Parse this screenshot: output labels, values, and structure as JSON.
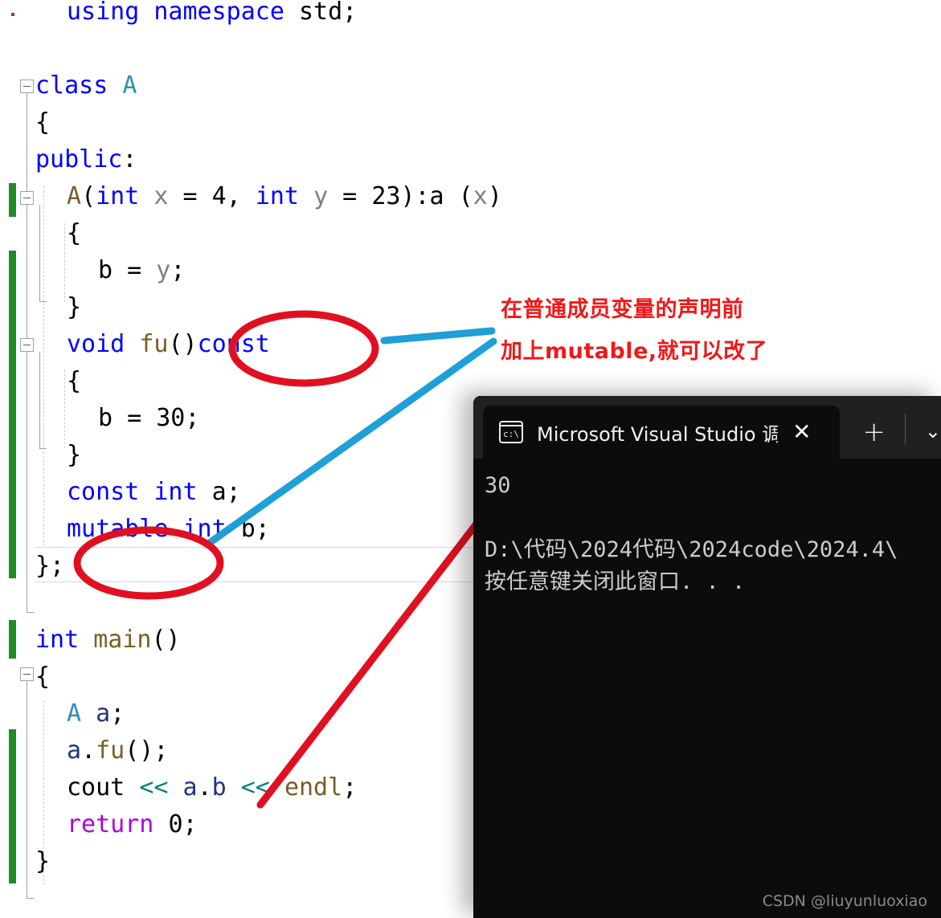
{
  "editor": {
    "lines": [
      {
        "indent": 1,
        "tokens": [
          {
            "t": "using",
            "c": "kw"
          },
          {
            "t": " ",
            "c": "plain"
          },
          {
            "t": "namespace",
            "c": "kw"
          },
          {
            "t": " std;",
            "c": "plain"
          }
        ]
      },
      {
        "indent": 0,
        "tokens": []
      },
      {
        "indent": 0,
        "tokens": [
          {
            "t": "class",
            "c": "kw"
          },
          {
            "t": " ",
            "c": "plain"
          },
          {
            "t": "A",
            "c": "type"
          }
        ]
      },
      {
        "indent": 0,
        "tokens": [
          {
            "t": "{",
            "c": "plain"
          }
        ]
      },
      {
        "indent": 0,
        "tokens": [
          {
            "t": "public",
            "c": "kw"
          },
          {
            "t": ":",
            "c": "plain"
          }
        ]
      },
      {
        "indent": 1,
        "tokens": [
          {
            "t": "A",
            "c": "fn"
          },
          {
            "t": "(",
            "c": "plain"
          },
          {
            "t": "int",
            "c": "kw"
          },
          {
            "t": " ",
            "c": "plain"
          },
          {
            "t": "x",
            "c": "var"
          },
          {
            "t": " = ",
            "c": "plain"
          },
          {
            "t": "4",
            "c": "num"
          },
          {
            "t": ", ",
            "c": "plain"
          },
          {
            "t": "int",
            "c": "kw"
          },
          {
            "t": " ",
            "c": "plain"
          },
          {
            "t": "y",
            "c": "var"
          },
          {
            "t": " = ",
            "c": "plain"
          },
          {
            "t": "23",
            "c": "num"
          },
          {
            "t": "):a (",
            "c": "plain"
          },
          {
            "t": "x",
            "c": "var"
          },
          {
            "t": ")",
            "c": "plain"
          }
        ]
      },
      {
        "indent": 1,
        "tokens": [
          {
            "t": "{",
            "c": "plain"
          }
        ]
      },
      {
        "indent": 2,
        "tokens": [
          {
            "t": "b",
            "c": "plain"
          },
          {
            "t": " = ",
            "c": "plain"
          },
          {
            "t": "y",
            "c": "var"
          },
          {
            "t": ";",
            "c": "plain"
          }
        ]
      },
      {
        "indent": 1,
        "tokens": [
          {
            "t": "}",
            "c": "plain"
          }
        ]
      },
      {
        "indent": 1,
        "tokens": [
          {
            "t": "void",
            "c": "kw"
          },
          {
            "t": " ",
            "c": "plain"
          },
          {
            "t": "fu",
            "c": "fn"
          },
          {
            "t": "()",
            "c": "plain"
          },
          {
            "t": "const",
            "c": "kw"
          }
        ]
      },
      {
        "indent": 1,
        "tokens": [
          {
            "t": "{",
            "c": "plain"
          }
        ]
      },
      {
        "indent": 2,
        "tokens": [
          {
            "t": "b",
            "c": "plain"
          },
          {
            "t": " = ",
            "c": "plain"
          },
          {
            "t": "30",
            "c": "num"
          },
          {
            "t": ";",
            "c": "plain"
          }
        ]
      },
      {
        "indent": 1,
        "tokens": [
          {
            "t": "}",
            "c": "plain"
          }
        ]
      },
      {
        "indent": 1,
        "tokens": [
          {
            "t": "const",
            "c": "kw"
          },
          {
            "t": " ",
            "c": "plain"
          },
          {
            "t": "int",
            "c": "kw"
          },
          {
            "t": " a;",
            "c": "plain"
          }
        ]
      },
      {
        "indent": 1,
        "tokens": [
          {
            "t": "mutable",
            "c": "mut"
          },
          {
            "t": " ",
            "c": "plain"
          },
          {
            "t": "int",
            "c": "kw"
          },
          {
            "t": " b;",
            "c": "plain"
          }
        ]
      },
      {
        "indent": 0,
        "tokens": [
          {
            "t": "};",
            "c": "plain"
          }
        ]
      },
      {
        "indent": 0,
        "tokens": []
      },
      {
        "indent": 0,
        "tokens": [
          {
            "t": "int",
            "c": "kw"
          },
          {
            "t": " ",
            "c": "plain"
          },
          {
            "t": "main",
            "c": "fn"
          },
          {
            "t": "()",
            "c": "plain"
          }
        ]
      },
      {
        "indent": 0,
        "tokens": [
          {
            "t": "{",
            "c": "plain"
          }
        ]
      },
      {
        "indent": 1,
        "tokens": [
          {
            "t": "A",
            "c": "type"
          },
          {
            "t": " ",
            "c": "plain"
          },
          {
            "t": "a",
            "c": "memb"
          },
          {
            "t": ";",
            "c": "plain"
          }
        ]
      },
      {
        "indent": 1,
        "tokens": [
          {
            "t": "a",
            "c": "memb"
          },
          {
            "t": ".",
            "c": "plain"
          },
          {
            "t": "fu",
            "c": "fn"
          },
          {
            "t": "();",
            "c": "plain"
          }
        ]
      },
      {
        "indent": 1,
        "tokens": [
          {
            "t": "cout",
            "c": "plain"
          },
          {
            "t": " ",
            "c": "plain"
          },
          {
            "t": "<<",
            "c": "shift"
          },
          {
            "t": " ",
            "c": "plain"
          },
          {
            "t": "a",
            "c": "memb"
          },
          {
            "t": ".",
            "c": "plain"
          },
          {
            "t": "b",
            "c": "memb"
          },
          {
            "t": " ",
            "c": "plain"
          },
          {
            "t": "<<",
            "c": "shift"
          },
          {
            "t": " ",
            "c": "plain"
          },
          {
            "t": "endl",
            "c": "fn"
          },
          {
            "t": ";",
            "c": "plain"
          }
        ]
      },
      {
        "indent": 1,
        "tokens": [
          {
            "t": "return",
            "c": "ctl"
          },
          {
            "t": " ",
            "c": "plain"
          },
          {
            "t": "0",
            "c": "num"
          },
          {
            "t": ";",
            "c": "plain"
          }
        ]
      },
      {
        "indent": 0,
        "tokens": [
          {
            "t": "}",
            "c": "plain"
          }
        ]
      }
    ],
    "plain_code": [
      "using namespace std;",
      "",
      "class A",
      "{",
      "public:",
      "    A(int x = 4, int y = 23):a (x)",
      "    {",
      "        b = y;",
      "    }",
      "    void fu()const",
      "    {",
      "        b = 30;",
      "    }",
      "    const int a;",
      "    mutable int b;",
      "};",
      "",
      "int main()",
      "{",
      "    A a;",
      "    a.fu();",
      "    cout << a.b << endl;",
      "    return 0;",
      "}"
    ]
  },
  "annotations": {
    "note_line1": "在普通成员变量的声明前",
    "note_line2": "加上mutable,就可以改了",
    "note_color": "#f01818",
    "ellipse_color": "#e01020",
    "blue_line_color": "#1e9fd8",
    "red_line_color": "#e01020",
    "circled_terms": [
      "const",
      "mutable"
    ]
  },
  "terminal": {
    "tab_title": "Microsoft Visual Studio 调试控",
    "tab_icon_label": "c:\\",
    "close_label": "✕",
    "new_tab_label": "+",
    "dropdown_label": "⌄",
    "output_lines": [
      "30",
      "",
      "D:\\代码\\2024代码\\2024code\\2024.4\\",
      "按任意键关闭此窗口. . ."
    ],
    "background": "#0c0c0c",
    "titlebar_background": "#202020"
  },
  "watermark": {
    "text": "CSDN @liuyunluoxiao"
  }
}
